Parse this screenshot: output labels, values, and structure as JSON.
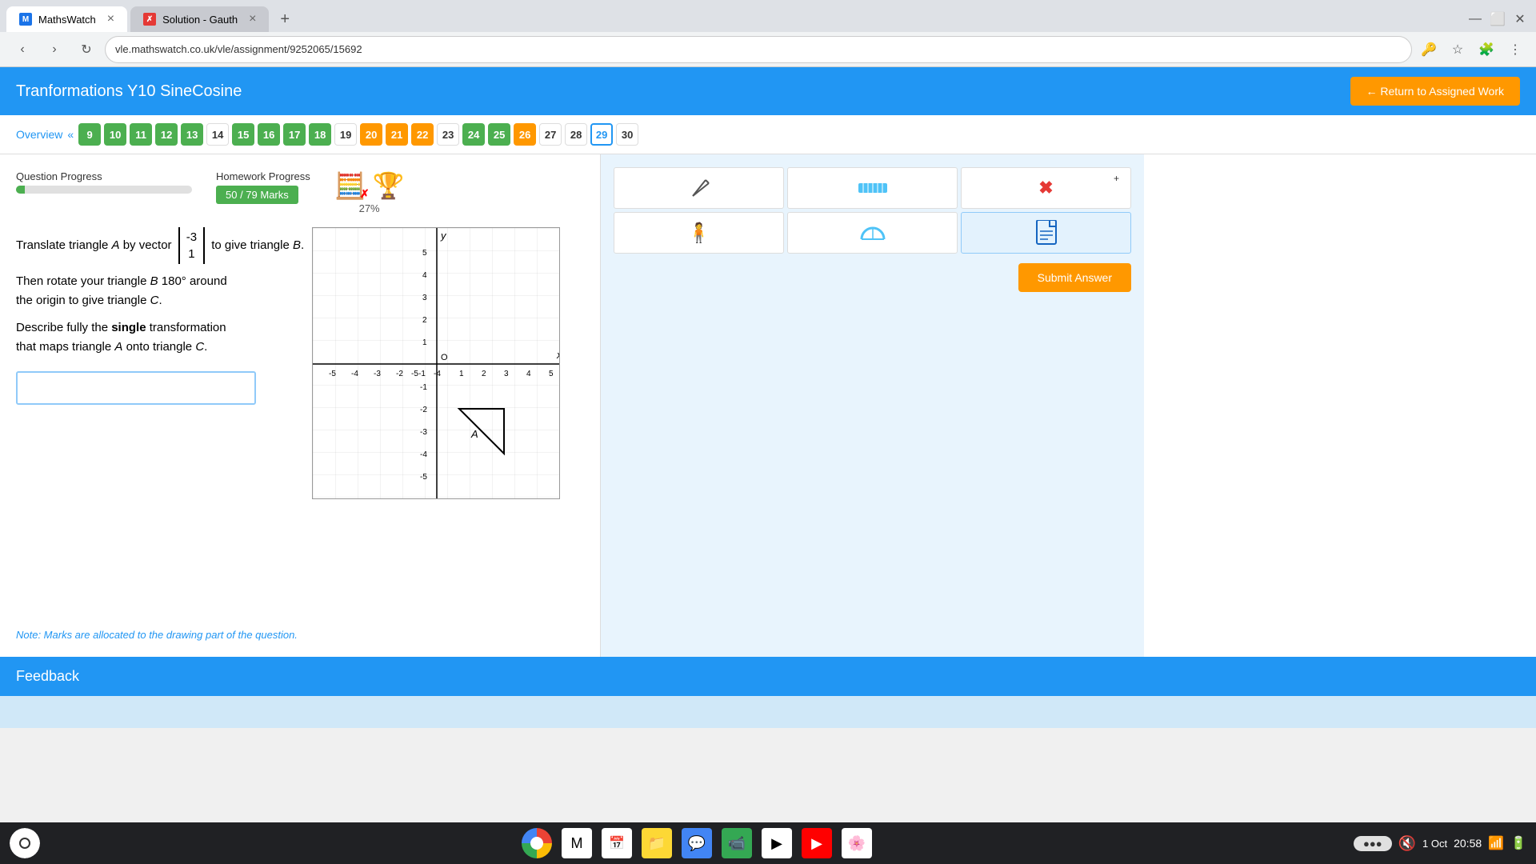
{
  "browser": {
    "tabs": [
      {
        "label": "MathsWatch",
        "active": true,
        "favicon": "mathswatch"
      },
      {
        "label": "Solution - Gauth",
        "active": false,
        "favicon": "gauth"
      }
    ],
    "url": "vle.mathswatch.co.uk/vle/assignment/9252065/15692",
    "new_tab_label": "+"
  },
  "header": {
    "title": "Tranformations Y10 SineCosine",
    "return_btn": "← Return to Assigned Work"
  },
  "nav": {
    "overview": "Overview",
    "chevron": "«",
    "numbers": [
      {
        "n": "9",
        "style": "green"
      },
      {
        "n": "10",
        "style": "green"
      },
      {
        "n": "11",
        "style": "green"
      },
      {
        "n": "12",
        "style": "green"
      },
      {
        "n": "13",
        "style": "green"
      },
      {
        "n": "14",
        "style": "plain"
      },
      {
        "n": "15",
        "style": "green"
      },
      {
        "n": "16",
        "style": "green"
      },
      {
        "n": "17",
        "style": "green"
      },
      {
        "n": "18",
        "style": "green"
      },
      {
        "n": "19",
        "style": "plain"
      },
      {
        "n": "20",
        "style": "yellow"
      },
      {
        "n": "21",
        "style": "yellow"
      },
      {
        "n": "22",
        "style": "yellow"
      },
      {
        "n": "23",
        "style": "plain"
      },
      {
        "n": "24",
        "style": "green"
      },
      {
        "n": "25",
        "style": "green"
      },
      {
        "n": "26",
        "style": "yellow"
      },
      {
        "n": "27",
        "style": "plain"
      },
      {
        "n": "28",
        "style": "plain"
      },
      {
        "n": "29",
        "style": "blue-border"
      },
      {
        "n": "30",
        "style": "plain"
      }
    ]
  },
  "progress": {
    "question_label": "Question Progress",
    "homework_label": "Homework Progress",
    "homework_value": "50 / 79 Marks",
    "percent": "27%"
  },
  "question": {
    "text1": "Translate triangle ",
    "A1": "A",
    "text2": " by vector",
    "vector_top": "-3",
    "vector_bottom": "1",
    "text3": "to give triangle ",
    "B1": "B",
    "text4": ".",
    "text5": "Then rotate your triangle ",
    "B2": "B",
    "text6": " 180° around",
    "text7": "the origin to give triangle ",
    "C1": "C",
    "text8": ".",
    "text9": "Describe fully the",
    "bold9": "single",
    "text10": "transformation",
    "text11": "that maps triangle",
    "A2": "A",
    "text12": "onto triangle",
    "C2": "C",
    "text13": ".",
    "answer_placeholder": "",
    "note": "Note: Marks are allocated to the drawing part of the question."
  },
  "tools": [
    {
      "icon": "✏️",
      "label": "pencil"
    },
    {
      "icon": "📏",
      "label": "ruler"
    },
    {
      "icon": "✖",
      "label": "eraser-plus"
    },
    {
      "icon": "🧍",
      "label": "figure"
    },
    {
      "icon": "🌙",
      "label": "protractor"
    },
    {
      "icon": "📄",
      "label": "page"
    }
  ],
  "submit_btn": "Submit Answer",
  "feedback": {
    "title": "Feedback"
  },
  "taskbar": {
    "time": "20:58",
    "date": "1 Oct",
    "month": "Oct"
  }
}
